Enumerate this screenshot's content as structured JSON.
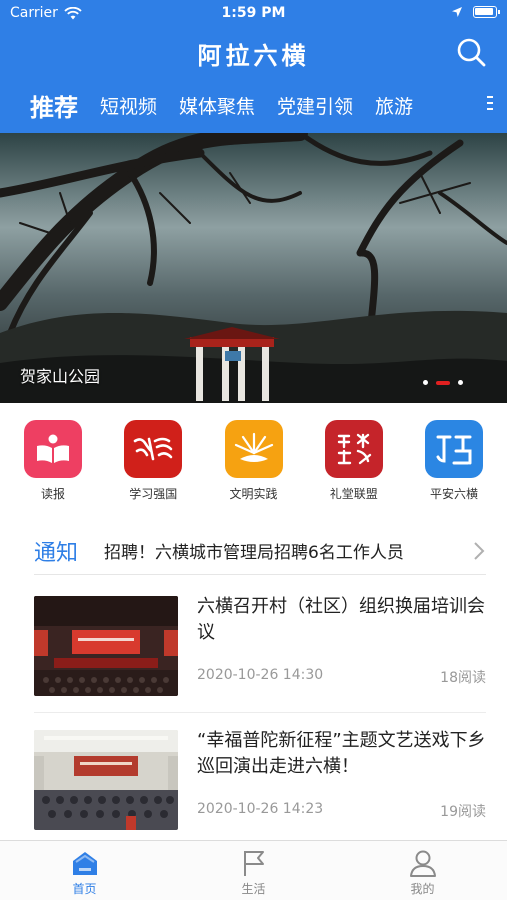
{
  "status_bar": {
    "carrier": "Carrier",
    "time": "1:59 PM"
  },
  "header": {
    "title": "阿拉六横",
    "search_icon": "search-icon"
  },
  "categories": [
    {
      "label": "推荐",
      "active": true
    },
    {
      "label": "短视频"
    },
    {
      "label": "媒体聚焦"
    },
    {
      "label": "党建引领"
    },
    {
      "label": "旅游"
    }
  ],
  "banner": {
    "caption": "贺家山公园",
    "slides": 3,
    "active_slide": 2
  },
  "quick_links": [
    {
      "label": "读报",
      "icon": "book-icon",
      "color": "#ee3f62"
    },
    {
      "label": "学习强国",
      "icon": "xuexi-logo-icon",
      "color": "#d0201a"
    },
    {
      "label": "文明实践",
      "icon": "sunburst-icon",
      "color": "#f6a211"
    },
    {
      "label": "礼堂联盟",
      "icon": "calligraphy-seal-icon",
      "color": "#c5242a"
    },
    {
      "label": "平安六横",
      "icon": "pingan-logo-icon",
      "color": "#2b86e3"
    }
  ],
  "notice": {
    "tag": "通知",
    "text": "招聘！六横城市管理局招聘6名工作人员"
  },
  "news": [
    {
      "title": "六横召开村（社区）组织换届培训会议",
      "date": "2020-10-26 14:30",
      "reads": "18阅读"
    },
    {
      "title": "“幸福普陀新征程”主题文艺送戏下乡巡回演出走进六横！",
      "date": "2020-10-26 14:23",
      "reads": "19阅读"
    }
  ],
  "tabs": [
    {
      "label": "首页",
      "icon": "home-icon",
      "active": true
    },
    {
      "label": "生活",
      "icon": "flag-icon"
    },
    {
      "label": "我的",
      "icon": "user-icon"
    }
  ],
  "colors": {
    "brand_blue": "#2f7fe6",
    "active_dot": "#e02020"
  }
}
